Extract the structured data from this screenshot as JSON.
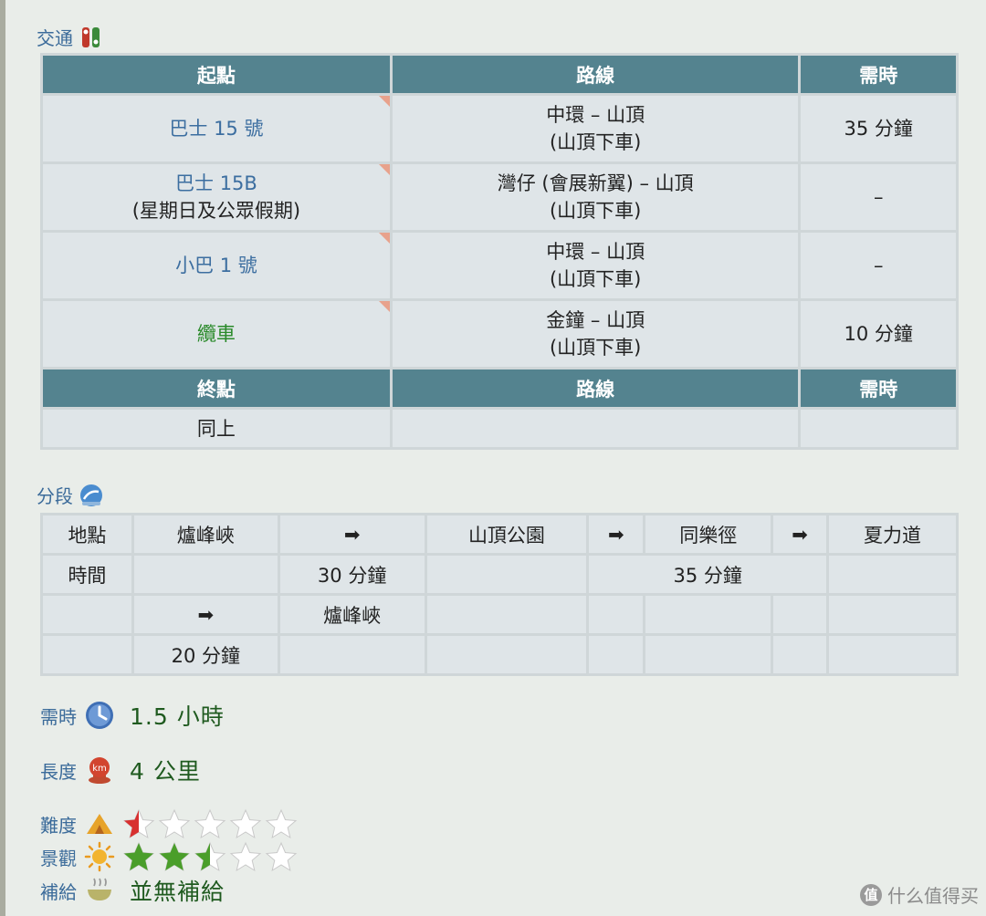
{
  "transport": {
    "heading": "交通",
    "headers": {
      "start": "起點",
      "route": "路線",
      "time": "需時"
    },
    "rows": [
      {
        "start": "巴士 15 號",
        "start2": "",
        "route1": "中環 – 山頂",
        "route2": "(山頂下車)",
        "time": "35 分鐘"
      },
      {
        "start": "巴士 15B",
        "start2": "(星期日及公眾假期)",
        "route1": "灣仔 (會展新翼) – 山頂",
        "route2": "(山頂下車)",
        "time": "–"
      },
      {
        "start": "小巴 1 號",
        "start2": "",
        "route1": "中環 – 山頂",
        "route2": "(山頂下車)",
        "time": "–"
      },
      {
        "start": "纜車",
        "start2": "",
        "route1": "金鐘 – 山頂",
        "route2": "(山頂下車)",
        "time": "10 分鐘"
      }
    ],
    "end_headers": {
      "end": "終點",
      "route": "路線",
      "time": "需時"
    },
    "end_row": {
      "end": "同上",
      "route": "",
      "time": ""
    }
  },
  "segments": {
    "heading": "分段",
    "row_location_label": "地點",
    "row_time_label": "時間",
    "loc1": "爐峰峽",
    "loc2": "山頂公園",
    "loc3": "同樂徑",
    "loc4": "夏力道",
    "time1": "30 分鐘",
    "time2": "35 分鐘",
    "loc5": "爐峰峽",
    "time3": "20 分鐘",
    "arrow": "➡"
  },
  "stats": {
    "duration_label": "需時",
    "duration_value": "1.5 小時",
    "length_label": "長度",
    "length_value": "4 公里",
    "km_badge": "km",
    "difficulty_label": "難度",
    "difficulty_rating": 0.5,
    "scenery_label": "景觀",
    "scenery_rating": 2.5,
    "supply_label": "補給",
    "supply_value": "並無補給"
  },
  "watermark": {
    "badge": "值",
    "text": "什么值得买"
  },
  "colors": {
    "header_bg": "#54838f",
    "link_blue": "#3c6ea0",
    "tram_green": "#2a8a2a",
    "star_red": "#d8302f",
    "star_green": "#4a9e2a"
  }
}
